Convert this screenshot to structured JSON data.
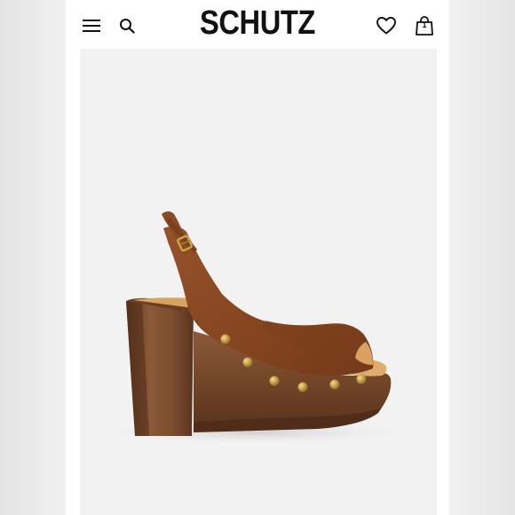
{
  "header": {
    "brand": "SCHUTZ",
    "icons": {
      "menu": "menu-icon",
      "search": "search-icon",
      "wishlist": "heart-icon",
      "bag": "shopping-bag-icon"
    },
    "bag_count": "1"
  },
  "product": {
    "image": "brown-suede-slingback-platform-sandal",
    "colors": {
      "suede": "#8b4a24",
      "wood": "#7a4a2c",
      "studs": "#c9a24a",
      "background": "#f2f2f2"
    }
  }
}
